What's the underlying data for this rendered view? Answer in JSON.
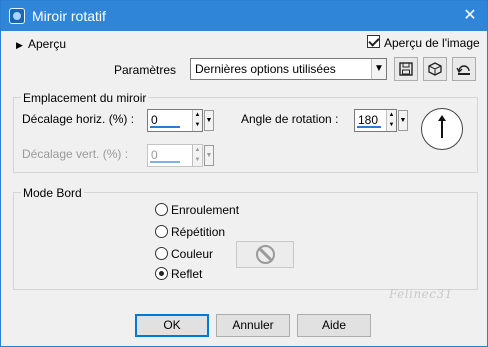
{
  "window": {
    "title": "Miroir rotatif",
    "close_icon": "close-icon"
  },
  "header": {
    "expander_label": "Aperçu",
    "preview_checkbox_label": "Aperçu de l'image",
    "preview_checked": true
  },
  "params": {
    "label": "Paramètres",
    "combo_value": "Dernières options utilisées",
    "tool_icons": [
      "save-preset-icon",
      "random-dice-icon",
      "reset-icon"
    ]
  },
  "mirror": {
    "group_label": "Emplacement du miroir",
    "horiz_label": "Décalage horiz. (%) :",
    "horiz_value": "0",
    "vert_label": "Décalage vert. (%) :",
    "vert_value": "0",
    "angle_label": "Angle de rotation :",
    "angle_value": "180",
    "dial_icon": "rotation-dial"
  },
  "edge": {
    "group_label": "Mode Bord",
    "options": [
      {
        "label": "Enroulement",
        "checked": false
      },
      {
        "label": "Répétition",
        "checked": false
      },
      {
        "label": "Couleur",
        "checked": false
      },
      {
        "label": "Reflet",
        "checked": true
      }
    ],
    "color_icon": "no-color-icon"
  },
  "watermark": "Felinec31",
  "buttons": {
    "ok": "OK",
    "cancel": "Annuler",
    "help": "Aide"
  },
  "colors": {
    "titlebar": "#2f86d8",
    "accent": "#0078d7",
    "value_bar": "#2d7ad6"
  }
}
